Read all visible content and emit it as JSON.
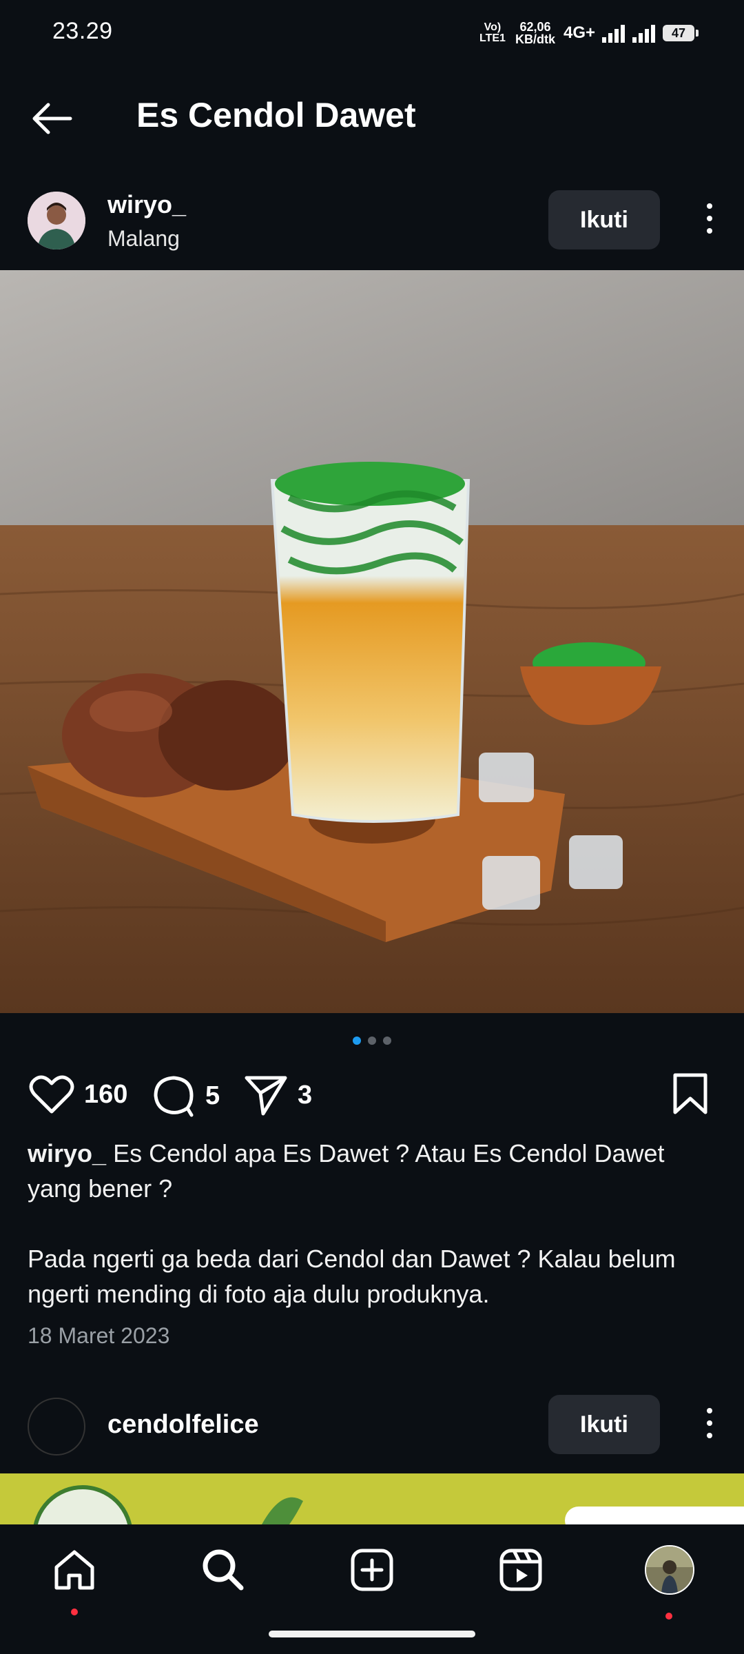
{
  "status_bar": {
    "time": "23.29",
    "volte_label": "Vo) LTE1",
    "net_speed": "62,06 KB/dtk",
    "network_type": "4G+",
    "battery": "47"
  },
  "header": {
    "title": "Es Cendol Dawet"
  },
  "post": {
    "author": "wiryo_",
    "location": "Malang",
    "follow_label": "Ikuti",
    "likes": "160",
    "comments": "5",
    "shares": "3",
    "caption_author": "wiryo_",
    "caption_line1": "Es Cendol apa Es Dawet ? Atau Es Cendol Dawet yang bener ?",
    "caption_line2": "Pada ngerti ga beda dari Cendol dan Dawet ? Kalau belum ngerti mending di foto aja dulu produknya.",
    "date": "18 Maret 2023",
    "carousel": {
      "count": 3,
      "active_index": 0
    }
  },
  "next_post": {
    "author": "cendolfelice",
    "follow_label": "Ikuti"
  },
  "bottom_nav": {
    "items": [
      "home-icon",
      "search-icon",
      "create-icon",
      "reels-icon",
      "profile-avatar"
    ]
  },
  "colors": {
    "background": "#0b0f14",
    "active_dot": "#1d9bf0",
    "notification": "#ff3040"
  }
}
